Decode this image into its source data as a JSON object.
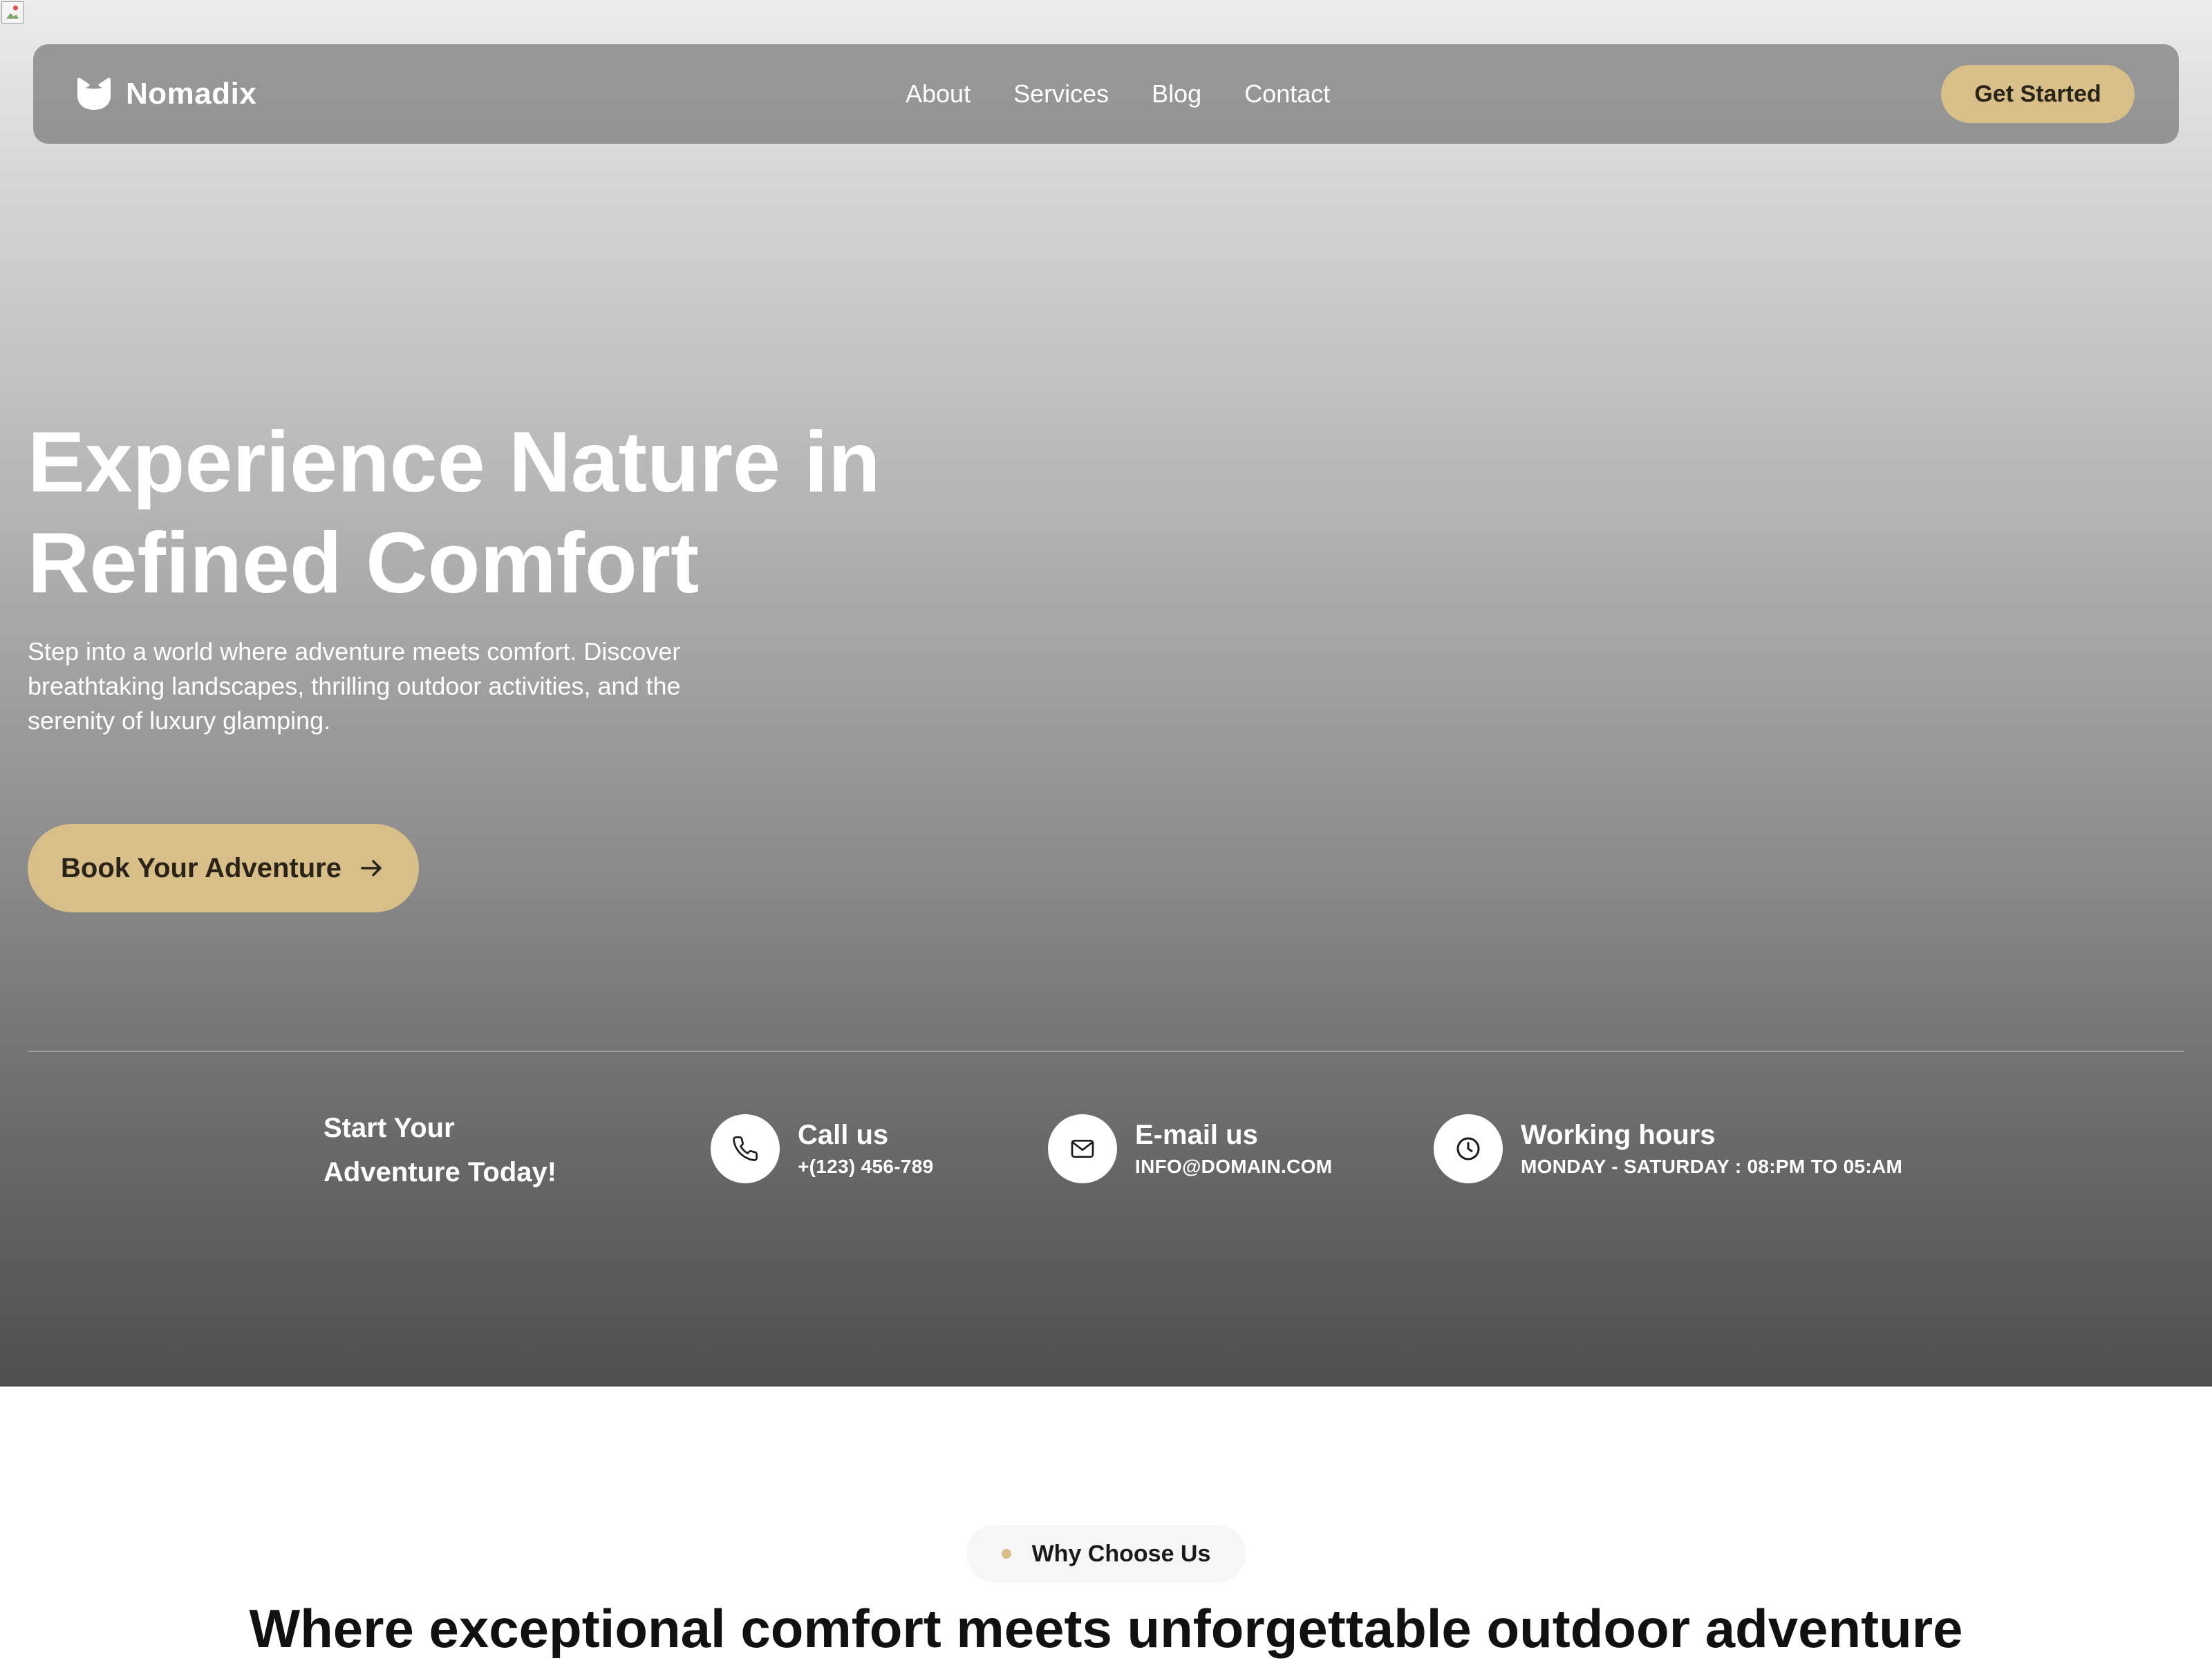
{
  "nav": {
    "brand": "Nomadix",
    "links": [
      "About",
      "Services",
      "Blog",
      "Contact"
    ],
    "cta": "Get Started"
  },
  "hero": {
    "title_line1": "Experience Nature in",
    "title_line2": "Refined Comfort",
    "description": "Step into a world where adventure meets comfort. Discover breathtaking landscapes, thrilling outdoor activities, and the serenity of luxury glamping.",
    "button": "Book Your Adventure",
    "button_icon": "arrow-right-icon"
  },
  "contact_bar": {
    "start_line1": "Start Your",
    "start_line2": "Adventure Today!",
    "items": [
      {
        "icon": "phone-icon",
        "label": "Call us",
        "value": "+(123) 456-789"
      },
      {
        "icon": "mail-icon",
        "label": "E-mail us",
        "value": "INFO@DOMAIN.COM"
      },
      {
        "icon": "clock-icon",
        "label": "Working hours",
        "value": "MONDAY - SATURDAY : 08:PM TO 05:AM"
      }
    ]
  },
  "why": {
    "badge": "Why Choose Us",
    "title": "Where exceptional comfort meets unforgettable outdoor adventure"
  },
  "colors": {
    "accent": "#d8be88",
    "navbar": "#7a7a7c",
    "text_dark": "#1a1a1a",
    "white": "#ffffff"
  }
}
